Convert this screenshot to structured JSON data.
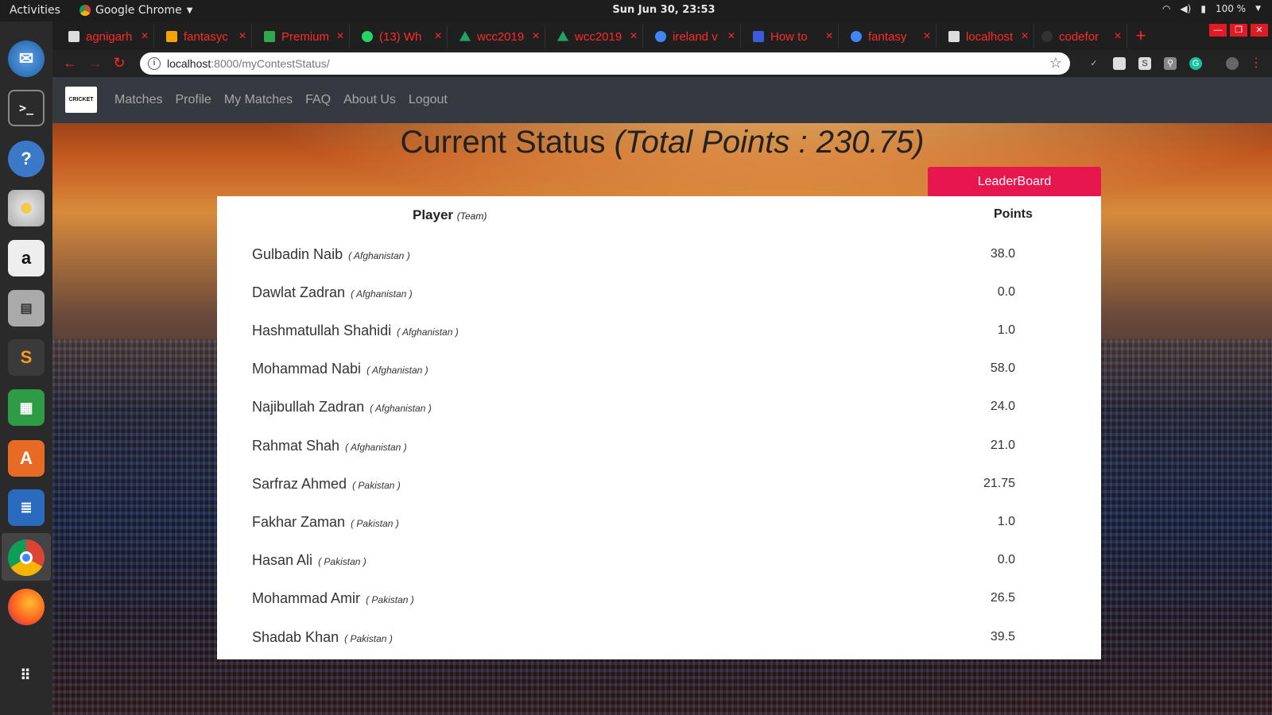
{
  "system": {
    "activities": "Activities",
    "app_name": "Google Chrome",
    "clock": "Sun Jun 30, 23:53",
    "battery": "100 %"
  },
  "browser": {
    "tabs": [
      {
        "title": "agnigarh",
        "favicon_color": "#dddddd"
      },
      {
        "title": "fantasyc",
        "favicon_color": "#f4a300"
      },
      {
        "title": "Premium",
        "favicon_color": "#2fa84f"
      },
      {
        "title": "(13) Wh",
        "favicon_color": "#25d366"
      },
      {
        "title": "wcc2019",
        "favicon_color": "#1fa463"
      },
      {
        "title": "wcc2019",
        "favicon_color": "#1fa463"
      },
      {
        "title": "ireland v",
        "favicon_color": "#4285f4"
      },
      {
        "title": "How to",
        "favicon_color": "#3b5bdb"
      },
      {
        "title": "fantasy",
        "favicon_color": "#4285f4"
      },
      {
        "title": "localhost",
        "favicon_color": "#dddddd"
      },
      {
        "title": "codefor",
        "favicon_color": "#333333"
      }
    ],
    "url_host": "localhost",
    "url_path": ":8000/myContestStatus/"
  },
  "site": {
    "nav": [
      "Matches",
      "Profile",
      "My Matches",
      "FAQ",
      "About Us",
      "Logout"
    ],
    "logo_text": "CRICKET"
  },
  "status": {
    "title": "Current Status",
    "total_points_label": "(Total Points : 230.75)",
    "leaderboard_button": "LeaderBoard",
    "col_player": "Player",
    "col_team": "(Team)",
    "col_points": "Points",
    "accent_color": "#e8164e",
    "players": [
      {
        "name": "Gulbadin Naib",
        "team": "( Afghanistan )",
        "points": "38.0"
      },
      {
        "name": "Dawlat Zadran",
        "team": "( Afghanistan )",
        "points": "0.0"
      },
      {
        "name": "Hashmatullah Shahidi",
        "team": "( Afghanistan )",
        "points": "1.0"
      },
      {
        "name": "Mohammad Nabi",
        "team": "( Afghanistan )",
        "points": "58.0"
      },
      {
        "name": "Najibullah Zadran",
        "team": "( Afghanistan )",
        "points": "24.0"
      },
      {
        "name": "Rahmat Shah",
        "team": "( Afghanistan )",
        "points": "21.0"
      },
      {
        "name": "Sarfraz Ahmed",
        "team": "( Pakistan )",
        "points": "21.75"
      },
      {
        "name": "Fakhar Zaman",
        "team": "( Pakistan )",
        "points": "1.0"
      },
      {
        "name": "Hasan Ali",
        "team": "( Pakistan )",
        "points": "0.0"
      },
      {
        "name": "Mohammad Amir",
        "team": "( Pakistan )",
        "points": "26.5"
      },
      {
        "name": "Shadab Khan",
        "team": "( Pakistan )",
        "points": "39.5"
      }
    ]
  }
}
